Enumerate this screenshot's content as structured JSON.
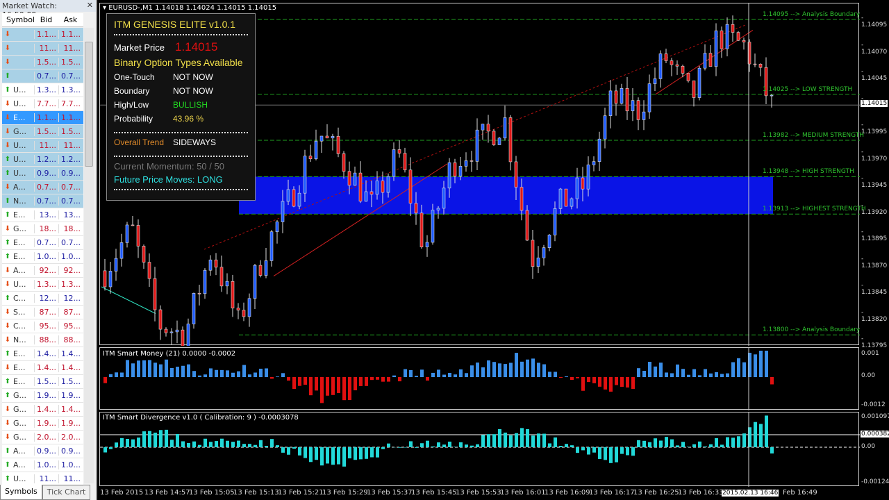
{
  "market_watch": {
    "title": "Market Watch: 16:50:09",
    "columns": [
      "Symbol",
      "Bid",
      "Ask"
    ],
    "rows": [
      {
        "dir": "down",
        "sym": "",
        "bid": "1.1...",
        "ask": "1.1...",
        "hl": true
      },
      {
        "dir": "down",
        "sym": "",
        "bid": "11...",
        "ask": "11...",
        "hl": true
      },
      {
        "dir": "down",
        "sym": "",
        "bid": "1.5...",
        "ask": "1.5...",
        "hl": true
      },
      {
        "dir": "up",
        "sym": "",
        "bid": "0.7...",
        "ask": "0.7...",
        "hl": true
      },
      {
        "dir": "up",
        "sym": "U...",
        "bid": "1.3...",
        "ask": "1.3..."
      },
      {
        "dir": "down",
        "sym": "U...",
        "bid": "7.7...",
        "ask": "7.7..."
      },
      {
        "dir": "down",
        "sym": "E...",
        "bid": "1.1...",
        "ask": "1.1...",
        "sel": true
      },
      {
        "dir": "down",
        "sym": "G...",
        "bid": "1.5...",
        "ask": "1.5...",
        "hl": true
      },
      {
        "dir": "down",
        "sym": "U...",
        "bid": "11...",
        "ask": "11...",
        "hl": true
      },
      {
        "dir": "up",
        "sym": "U...",
        "bid": "1.2...",
        "ask": "1.2...",
        "hl": true
      },
      {
        "dir": "up",
        "sym": "U...",
        "bid": "0.9...",
        "ask": "0.9...",
        "hl": true
      },
      {
        "dir": "down",
        "sym": "A...",
        "bid": "0.7...",
        "ask": "0.7...",
        "hl": true
      },
      {
        "dir": "up",
        "sym": "N...",
        "bid": "0.7...",
        "ask": "0.7...",
        "hl": true
      },
      {
        "dir": "up",
        "sym": "E...",
        "bid": "13...",
        "ask": "13..."
      },
      {
        "dir": "down",
        "sym": "G...",
        "bid": "18...",
        "ask": "18..."
      },
      {
        "dir": "up",
        "sym": "E...",
        "bid": "0.7...",
        "ask": "0.7..."
      },
      {
        "dir": "up",
        "sym": "E...",
        "bid": "1.0...",
        "ask": "1.0..."
      },
      {
        "dir": "down",
        "sym": "A...",
        "bid": "92...",
        "ask": "92..."
      },
      {
        "dir": "down",
        "sym": "U...",
        "bid": "1.3...",
        "ask": "1.3..."
      },
      {
        "dir": "up",
        "sym": "C...",
        "bid": "12...",
        "ask": "12..."
      },
      {
        "dir": "down",
        "sym": "S...",
        "bid": "87...",
        "ask": "87..."
      },
      {
        "dir": "down",
        "sym": "C...",
        "bid": "95...",
        "ask": "95..."
      },
      {
        "dir": "down",
        "sym": "N...",
        "bid": "88...",
        "ask": "88..."
      },
      {
        "dir": "up",
        "sym": "E...",
        "bid": "1.4...",
        "ask": "1.4..."
      },
      {
        "dir": "down",
        "sym": "E...",
        "bid": "1.4...",
        "ask": "1.4..."
      },
      {
        "dir": "up",
        "sym": "E...",
        "bid": "1.5...",
        "ask": "1.5..."
      },
      {
        "dir": "up",
        "sym": "G...",
        "bid": "1.9...",
        "ask": "1.9..."
      },
      {
        "dir": "down",
        "sym": "G...",
        "bid": "1.4...",
        "ask": "1.4..."
      },
      {
        "dir": "down",
        "sym": "G...",
        "bid": "1.9...",
        "ask": "1.9..."
      },
      {
        "dir": "down",
        "sym": "G...",
        "bid": "2.0...",
        "ask": "2.0..."
      },
      {
        "dir": "up",
        "sym": "A...",
        "bid": "0.9...",
        "ask": "0.9..."
      },
      {
        "dir": "up",
        "sym": "A...",
        "bid": "1.0...",
        "ask": "1.0..."
      },
      {
        "dir": "up",
        "sym": "U...",
        "bid": "11...",
        "ask": "11..."
      }
    ],
    "tabs": [
      "Symbols",
      "Tick Chart"
    ]
  },
  "chart": {
    "symbol_line": "EURUSD-,M1  1.14018 1.14024 1.14015 1.14015",
    "price_ticks": [
      "1.14095",
      "1.14070",
      "1.14045",
      "1.14020",
      "1.13995",
      "1.13970",
      "1.13945",
      "1.13920",
      "1.13895",
      "1.13870",
      "1.13845",
      "1.13820",
      "1.13795"
    ],
    "current_price": "1.14015",
    "levels": [
      {
        "price": 1.14095,
        "label": "1.14095 --> Analysis Boundary"
      },
      {
        "price": 1.14025,
        "label": "1.14025 --> LOW STRENGTH"
      },
      {
        "price": 1.13982,
        "label": "1.13982 --> MEDIUM STRENGTH"
      },
      {
        "price": 1.13948,
        "label": "1.13948 --> HIGH STRENGTH"
      },
      {
        "price": 1.13913,
        "label": "1.13913 --> HIGHEST STRENGTH"
      },
      {
        "price": 1.138,
        "label": "1.13800 --> Analysis Boundary"
      }
    ],
    "price_path": [
      1.1386,
      1.139,
      1.1381,
      1.138,
      1.1388,
      1.1381,
      1.1388,
      1.1393,
      1.1399,
      1.1396,
      1.1392,
      1.1397,
      1.1388,
      1.1396,
      1.1398,
      1.14,
      1.1387,
      1.1392,
      1.1394,
      1.1402,
      1.1401,
      1.1406,
      1.1402,
      1.1408,
      1.1407,
      1.14015
    ],
    "time_ticks": [
      "13 Feb 2015",
      "13 Feb 14:57",
      "13 Feb 15:05",
      "13 Feb 15:13",
      "13 Feb 15:21",
      "13 Feb 15:29",
      "13 Feb 15:37",
      "13 Feb 15:45",
      "13 Feb 15:53",
      "13 Feb 16:01",
      "13 Feb 16:09",
      "13 Feb 16:17",
      "13 Feb 16:25",
      "13 Feb 16:33",
      "Feb 16:49"
    ],
    "crosshair_time": "2015.02.13 16:46"
  },
  "panel": {
    "title": "ITM GENESIS ELITE v1.0.1",
    "market_price_label": "Market Price",
    "market_price": "1.14015",
    "types_heading": "Binary Option Types Available",
    "rows": [
      {
        "k": "One-Touch",
        "v": "NOT NOW",
        "c": "#ffffff"
      },
      {
        "k": "Boundary",
        "v": "NOT NOW",
        "c": "#ffffff"
      },
      {
        "k": "High/Low",
        "v": "BULLISH",
        "c": "#22dd22"
      },
      {
        "k": "Probability",
        "v": "43.96 %",
        "c": "#e8d04a"
      }
    ],
    "trend_label": "Overall Trend",
    "trend": "SIDEWAYS",
    "momentum": "Current Momentum: 50 / 50",
    "future": "Future Price Moves: LONG"
  },
  "smart_money": {
    "title": "ITM Smart Money (21) 0.0000 -0.0002",
    "ticks": [
      "0.001",
      "0.00",
      "-0.0012"
    ]
  },
  "divergence": {
    "title": "ITM Smart Divergence v1.0 ( Calibration: 9 ) -0.0003078",
    "ticks": [
      "0.001097",
      "0.00",
      "-0.00124"
    ],
    "current": "0.000382"
  }
}
